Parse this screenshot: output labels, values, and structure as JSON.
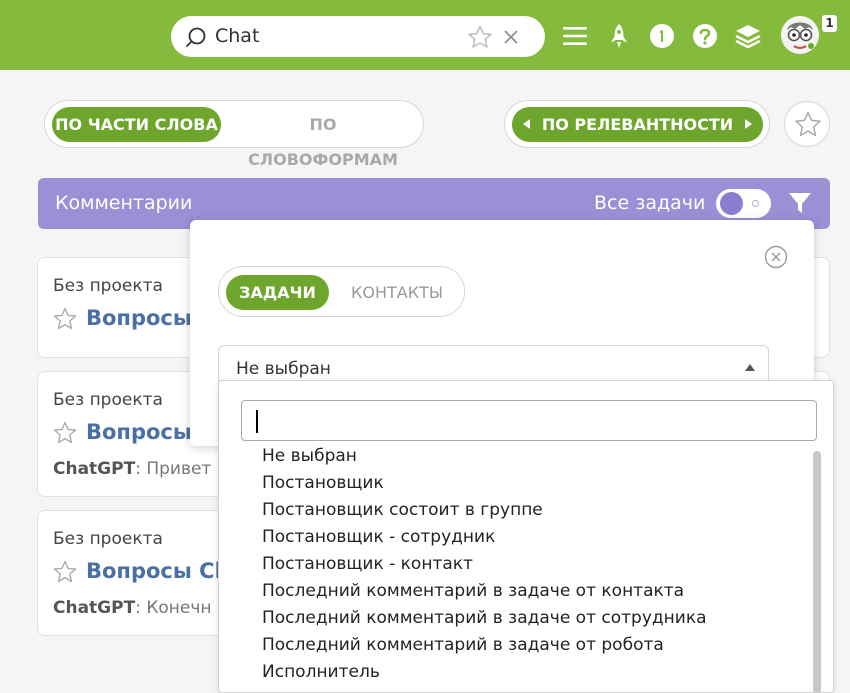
{
  "topbar": {
    "search_value": "Chat",
    "icons": [
      "search-icon",
      "star-icon",
      "close-icon",
      "menu-icon",
      "rocket-icon",
      "timer-icon",
      "help-icon",
      "layers-icon"
    ],
    "notification_count": "1",
    "accent": "#84bb3c"
  },
  "search_modes": {
    "active": "ПО ЧАСТИ СЛОВА",
    "inactive": "ПО СЛОВОФОРМАМ"
  },
  "sort": {
    "label": "ПО РЕЛЕВАНТНОСТИ"
  },
  "section": {
    "title": "Комментарии",
    "toggle_label": "Все задачи",
    "color": "#9c8fd6"
  },
  "results": [
    {
      "project": "Без проекта",
      "title": "Вопросы",
      "author": "",
      "snippet": ""
    },
    {
      "project": "Без проекта",
      "title": "Вопросы",
      "author": "ChatGPT",
      "snippet": ": Привет"
    },
    {
      "project": "Без проекта",
      "title": "Вопросы Ch",
      "author": "ChatGPT",
      "snippet": ": Конечн"
    }
  ],
  "filter_popup": {
    "tab_active": "ЗАДАЧИ",
    "tab_inactive": "КОНТАКТЫ",
    "select_value": "Не выбран"
  },
  "dropdown": {
    "search_value": "",
    "options": [
      "Не выбран",
      "Постановщик",
      "Постановщик состоит в группе",
      "Постановщик - сотрудник",
      "Постановщик - контакт",
      "Последний комментарий в задаче от контакта",
      "Последний комментарий в задаче от сотрудника",
      "Последний комментарий в задаче от робота",
      "Исполнитель"
    ]
  }
}
